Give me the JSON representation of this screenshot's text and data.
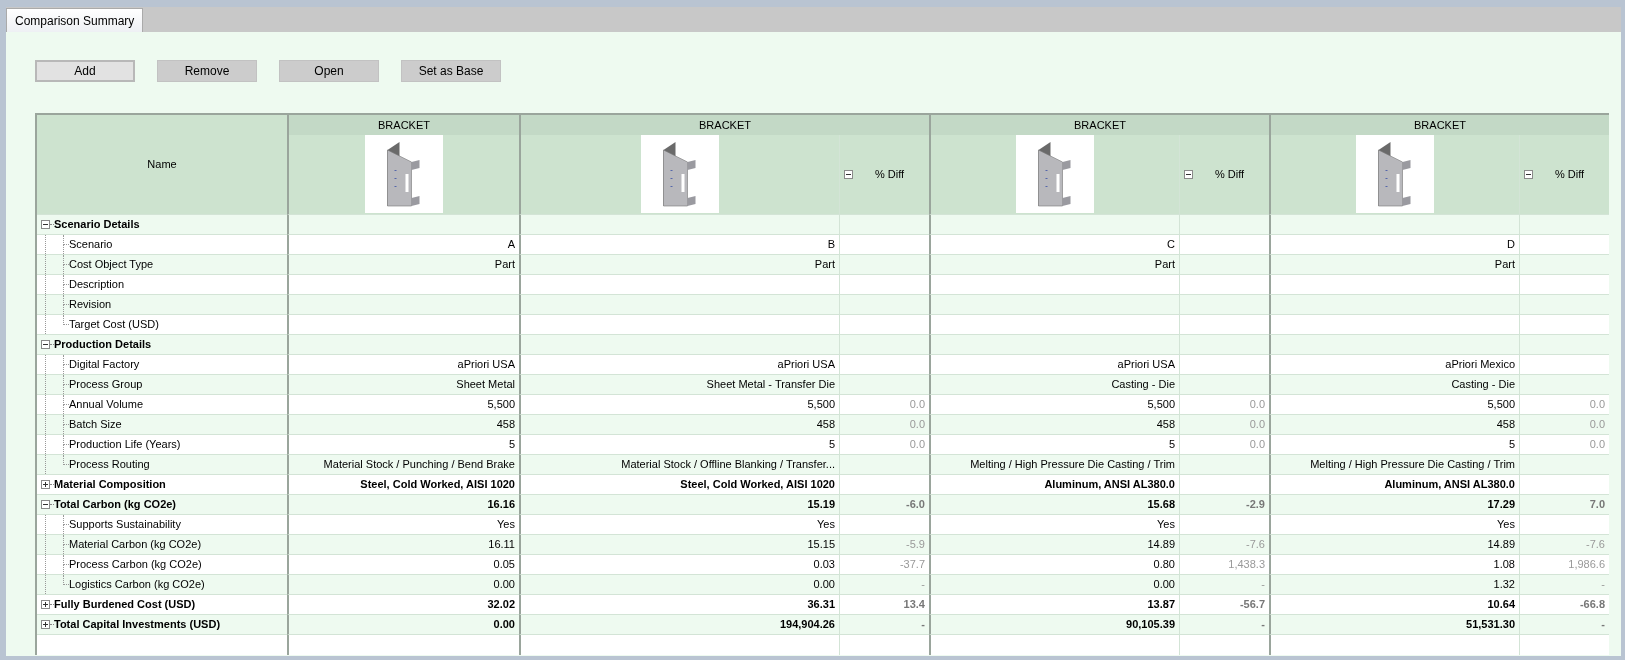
{
  "tab": {
    "label": "Comparison Summary",
    "selected": true
  },
  "buttons": [
    {
      "label": "Add",
      "default": true
    },
    {
      "label": "Remove",
      "default": false
    },
    {
      "label": "Open",
      "default": false
    },
    {
      "label": "Set as Base",
      "default": false
    }
  ],
  "table": {
    "name_header": "Name",
    "scenarios": [
      {
        "title": "BRACKET"
      },
      {
        "title": "BRACKET",
        "diff_label": "% Diff",
        "diff_expanded": true
      },
      {
        "title": "BRACKET",
        "diff_label": "% Diff",
        "diff_expanded": true
      },
      {
        "title": "BRACKET",
        "diff_label": "% Diff",
        "diff_expanded": true
      }
    ],
    "sections": [
      {
        "label": "Scenario Details",
        "expanded": true,
        "children": [
          {
            "label": "Scenario",
            "cells": {
              "a": "A",
              "b": "B",
              "c": "C",
              "d": "D"
            }
          },
          {
            "label": "Cost Object Type",
            "cells": {
              "a": "Part",
              "b": "Part",
              "c": "Part",
              "d": "Part"
            }
          },
          {
            "label": "Description"
          },
          {
            "label": "Revision"
          },
          {
            "label": "Target Cost (USD)"
          }
        ]
      },
      {
        "label": "Production Details",
        "expanded": true,
        "children": [
          {
            "label": "Digital Factory",
            "cells": {
              "a": "aPriori USA",
              "b": "aPriori USA",
              "c": "aPriori USA",
              "d": "aPriori Mexico"
            }
          },
          {
            "label": "Process Group",
            "cells": {
              "a": "Sheet Metal",
              "b": "Sheet Metal - Transfer Die",
              "c": "Casting - Die",
              "d": "Casting - Die"
            }
          },
          {
            "label": "Annual Volume",
            "cells": {
              "a": "5,500",
              "b": "5,500",
              "b_diff": "0.0",
              "c": "5,500",
              "c_diff": "0.0",
              "d": "5,500",
              "d_diff": "0.0"
            }
          },
          {
            "label": "Batch Size",
            "cells": {
              "a": "458",
              "b": "458",
              "b_diff": "0.0",
              "c": "458",
              "c_diff": "0.0",
              "d": "458",
              "d_diff": "0.0"
            }
          },
          {
            "label": "Production Life (Years)",
            "cells": {
              "a": "5",
              "b": "5",
              "b_diff": "0.0",
              "c": "5",
              "c_diff": "0.0",
              "d": "5",
              "d_diff": "0.0"
            }
          },
          {
            "label": "Process Routing",
            "cells": {
              "a": "Material Stock / Punching / Bend Brake",
              "b": "Material Stock / Offline Blanking / Transfer...",
              "c": "Melting / High Pressure Die Casting / Trim",
              "d": "Melting / High Pressure Die Casting / Trim"
            }
          }
        ]
      },
      {
        "label": "Material Composition",
        "expanded": false,
        "cells": {
          "a": "Steel, Cold Worked, AISI 1020",
          "b": "Steel, Cold Worked, AISI 1020",
          "c": "Aluminum, ANSI AL380.0",
          "d": "Aluminum, ANSI AL380.0"
        }
      },
      {
        "label": "Total Carbon (kg CO2e)",
        "expanded": true,
        "cells": {
          "a": "16.16",
          "b": "15.19",
          "b_diff": "-6.0",
          "c": "15.68",
          "c_diff": "-2.9",
          "d": "17.29",
          "d_diff": "7.0"
        },
        "children": [
          {
            "label": "Supports Sustainability",
            "cells": {
              "a": "Yes",
              "b": "Yes",
              "c": "Yes",
              "d": "Yes"
            }
          },
          {
            "label": "Material Carbon (kg CO2e)",
            "cells": {
              "a": "16.11",
              "b": "15.15",
              "b_diff": "-5.9",
              "c": "14.89",
              "c_diff": "-7.6",
              "d": "14.89",
              "d_diff": "-7.6"
            }
          },
          {
            "label": "Process Carbon (kg CO2e)",
            "cells": {
              "a": "0.05",
              "b": "0.03",
              "b_diff": "-37.7",
              "c": "0.80",
              "c_diff": "1,438.3",
              "d": "1.08",
              "d_diff": "1,986.6"
            }
          },
          {
            "label": "Logistics Carbon (kg CO2e)",
            "cells": {
              "a": "0.00",
              "b": "0.00",
              "b_diff": "-",
              "c": "0.00",
              "c_diff": "-",
              "d": "1.32",
              "d_diff": "-"
            }
          }
        ]
      },
      {
        "label": "Fully Burdened Cost (USD)",
        "expanded": false,
        "cells": {
          "a": "32.02",
          "b": "36.31",
          "b_diff": "13.4",
          "c": "13.87",
          "c_diff": "-56.7",
          "d": "10.64",
          "d_diff": "-66.8"
        }
      },
      {
        "label": "Total Capital Investments (USD)",
        "expanded": false,
        "cells": {
          "a": "0.00",
          "b": "194,904.26",
          "b_diff": "-",
          "c": "90,105.39",
          "c_diff": "-",
          "d": "51,531.30",
          "d_diff": "-"
        }
      }
    ]
  }
}
